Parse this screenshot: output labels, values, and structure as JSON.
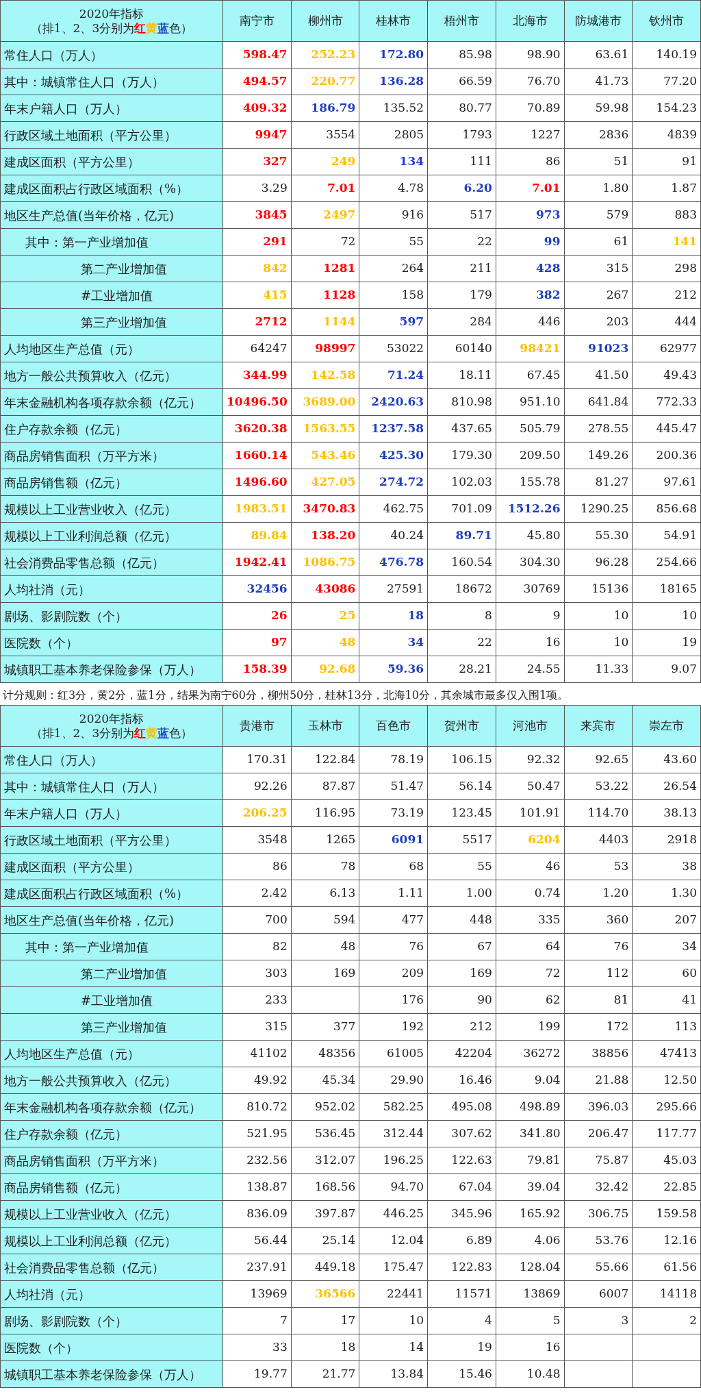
{
  "upper_table": {
    "header": {
      "title": "2020年指标",
      "legend": [
        {
          "text": "（排1、2、3分别为"
        },
        {
          "text": "红",
          "color": "#ff0000"
        },
        {
          "text": "黄",
          "color": "#ffc000"
        },
        {
          "text": "蓝",
          "color": "#1f3fc0"
        },
        {
          "text": "色）"
        }
      ]
    },
    "columns": [
      "南宁市",
      "柳州市",
      "桂林市",
      "梧州市",
      "北海市",
      "防城港市",
      "钦州市"
    ],
    "rows": [
      {
        "label": "常住人口（万人）",
        "cells": [
          {
            "value": "598.47",
            "color": "#ff0000"
          },
          {
            "value": "252.23",
            "color": "#ffc000"
          },
          {
            "value": "172.80",
            "color": "#1f3fc0"
          },
          "85.98",
          "98.90",
          "63.61",
          "140.19"
        ]
      },
      {
        "label": "其中：城镇常住人口（万人）",
        "cells": [
          {
            "value": "494.57",
            "color": "#ff0000"
          },
          {
            "value": "220.77",
            "color": "#ffc000"
          },
          {
            "value": "136.28",
            "color": "#1f3fc0"
          },
          "66.59",
          "76.70",
          "41.73",
          "77.20"
        ]
      },
      {
        "label": "年末户籍人口（万人）",
        "cells": [
          {
            "value": "409.32",
            "color": "#ff0000"
          },
          {
            "value": "186.79",
            "color": "#1f3fc0"
          },
          "135.52",
          "80.77",
          "70.89",
          "59.98",
          "154.23"
        ]
      },
      {
        "label": "行政区域土地面积（平方公里）",
        "cells": [
          {
            "value": "9947",
            "color": "#ff0000"
          },
          "3554",
          "2805",
          "1793",
          "1227",
          "2836",
          "4839"
        ]
      },
      {
        "label": "建成区面积（平方公里）",
        "cells": [
          {
            "value": "327",
            "color": "#ff0000"
          },
          {
            "value": "249",
            "color": "#ffc000"
          },
          {
            "value": "134",
            "color": "#1f3fc0"
          },
          "111",
          "86",
          "51",
          "91"
        ]
      },
      {
        "label": "建成区面积占行政区域面积（%）",
        "cells": [
          "3.29",
          {
            "value": "7.01",
            "color": "#ff0000"
          },
          "4.78",
          {
            "value": "6.20",
            "color": "#1f3fc0"
          },
          {
            "value": "7.01",
            "color": "#ff0000"
          },
          "1.80",
          "1.87"
        ]
      },
      {
        "label": "地区生产总值(当年价格，亿元)",
        "cells": [
          {
            "value": "3845",
            "color": "#ff0000"
          },
          {
            "value": "2497",
            "color": "#ffc000"
          },
          "916",
          "517",
          {
            "value": "973",
            "color": "#1f3fc0"
          },
          "579",
          "883"
        ],
        "children": [
          {
            "label": "其中：第一产业增加值",
            "cells": [
              {
                "value": "291",
                "color": "#ff0000"
              },
              "72",
              "55",
              "22",
              {
                "value": "99",
                "color": "#1f3fc0"
              },
              "61",
              {
                "value": "141",
                "color": "#ffc000"
              }
            ]
          },
          {
            "label": "第二产业增加值",
            "cells": [
              {
                "value": "842",
                "color": "#ffc000"
              },
              {
                "value": "1281",
                "color": "#ff0000"
              },
              "264",
              "211",
              {
                "value": "428",
                "color": "#1f3fc0"
              },
              "315",
              "298"
            ]
          },
          {
            "label": "#工业增加值",
            "cells": [
              {
                "value": "415",
                "color": "#ffc000"
              },
              {
                "value": "1128",
                "color": "#ff0000"
              },
              "158",
              "179",
              {
                "value": "382",
                "color": "#1f3fc0"
              },
              "267",
              "212"
            ]
          },
          {
            "label": "第三产业增加值",
            "cells": [
              {
                "value": "2712",
                "color": "#ff0000"
              },
              {
                "value": "1144",
                "color": "#ffc000"
              },
              {
                "value": "597",
                "color": "#1f3fc0"
              },
              "284",
              "446",
              "203",
              "444"
            ]
          }
        ]
      },
      {
        "label": "人均地区生产总值（元）",
        "cells": [
          "64247",
          {
            "value": "98997",
            "color": "#ff0000"
          },
          "53022",
          "60140",
          {
            "value": "98421",
            "color": "#ffc000"
          },
          {
            "value": "91023",
            "color": "#1f3fc0"
          },
          "62977"
        ]
      },
      {
        "label": "地方一般公共预算收入（亿元）",
        "cells": [
          {
            "value": "344.99",
            "color": "#ff0000"
          },
          {
            "value": "142.58",
            "color": "#ffc000"
          },
          {
            "value": "71.24",
            "color": "#1f3fc0"
          },
          "18.11",
          "67.45",
          "41.50",
          "49.43"
        ]
      },
      {
        "label": "年末金融机构各项存款余额（亿元）",
        "cells": [
          {
            "value": "10496.50",
            "color": "#ff0000"
          },
          {
            "value": "3689.00",
            "color": "#ffc000"
          },
          {
            "value": "2420.63",
            "color": "#1f3fc0"
          },
          "810.98",
          "951.10",
          "641.84",
          "772.33"
        ]
      },
      {
        "label": "住户存款余额（亿元）",
        "cells": [
          {
            "value": "3620.38",
            "color": "#ff0000"
          },
          {
            "value": "1563.55",
            "color": "#ffc000"
          },
          {
            "value": "1237.58",
            "color": "#1f3fc0"
          },
          "437.65",
          "505.79",
          "278.55",
          "445.47"
        ]
      },
      {
        "label": "商品房销售面积（万平方米）",
        "cells": [
          {
            "value": "1660.14",
            "color": "#ff0000"
          },
          {
            "value": "543.46",
            "color": "#ffc000"
          },
          {
            "value": "425.30",
            "color": "#1f3fc0"
          },
          "179.30",
          "209.50",
          "149.26",
          "200.36"
        ]
      },
      {
        "label": "商品房销售额（亿元）",
        "cells": [
          {
            "value": "1496.60",
            "color": "#ff0000"
          },
          {
            "value": "427.05",
            "color": "#ffc000"
          },
          {
            "value": "274.72",
            "color": "#1f3fc0"
          },
          "102.03",
          "155.78",
          "81.27",
          "97.61"
        ]
      },
      {
        "label": "规模以上工业营业收入（亿元）",
        "cells": [
          {
            "value": "1983.51",
            "color": "#ffc000"
          },
          {
            "value": "3470.83",
            "color": "#ff0000"
          },
          "462.75",
          "701.09",
          {
            "value": "1512.26",
            "color": "#1f3fc0"
          },
          "1290.25",
          "856.68"
        ]
      },
      {
        "label": "规模以上工业利润总额（亿元）",
        "cells": [
          {
            "value": "89.84",
            "color": "#ffc000"
          },
          {
            "value": "138.20",
            "color": "#ff0000"
          },
          "40.24",
          {
            "value": "89.71",
            "color": "#1f3fc0"
          },
          "45.80",
          "55.30",
          "54.91"
        ]
      },
      {
        "label": "社会消费品零售总额（亿元）",
        "cells": [
          {
            "value": "1942.41",
            "color": "#ff0000"
          },
          {
            "value": "1086.75",
            "color": "#ffc000"
          },
          {
            "value": "476.78",
            "color": "#1f3fc0"
          },
          "160.54",
          "304.30",
          "96.28",
          "254.66"
        ]
      },
      {
        "label": "人均社消（元）",
        "cells": [
          {
            "value": "32456",
            "color": "#1f3fc0"
          },
          {
            "value": "43086",
            "color": "#ff0000"
          },
          "27591",
          "18672",
          "30769",
          "15136",
          "18165"
        ]
      },
      {
        "label": "剧场、影剧院数（个）",
        "cells": [
          {
            "value": "26",
            "color": "#ff0000"
          },
          {
            "value": "25",
            "color": "#ffc000"
          },
          {
            "value": "18",
            "color": "#1f3fc0"
          },
          "8",
          "9",
          "10",
          "10"
        ]
      },
      {
        "label": "医院数（个）",
        "cells": [
          {
            "value": "97",
            "color": "#ff0000"
          },
          {
            "value": "48",
            "color": "#ffc000"
          },
          {
            "value": "34",
            "color": "#1f3fc0"
          },
          "22",
          "16",
          "10",
          "19"
        ]
      },
      {
        "label": "城镇职工基本养老保险参保（万人）",
        "cells": [
          {
            "value": "158.39",
            "color": "#ff0000"
          },
          {
            "value": "92.68",
            "color": "#ffc000"
          },
          {
            "value": "59.36",
            "color": "#1f3fc0"
          },
          "28.21",
          "24.55",
          "11.33",
          "9.07"
        ]
      }
    ]
  },
  "scoring_note": "计分规则：红3分，黄2分，蓝1分，结果为南宁60分，柳州50分，桂林13分，北海10分，其余城市最多仅入围1项。",
  "lower_table": {
    "header": {
      "title": "2020年指标",
      "legend": [
        {
          "text": "（排1、2、3分别为"
        },
        {
          "text": "红",
          "color": "#ff0000"
        },
        {
          "text": "黄",
          "color": "#ffc000"
        },
        {
          "text": "蓝",
          "color": "#1f3fc0"
        },
        {
          "text": "色）"
        }
      ]
    },
    "columns": [
      "贵港市",
      "玉林市",
      "百色市",
      "贺州市",
      "河池市",
      "来宾市",
      "崇左市"
    ],
    "rows": [
      {
        "label": "常住人口（万人）",
        "cells": [
          "170.31",
          "122.84",
          "78.19",
          "106.15",
          "92.32",
          "92.65",
          "43.60"
        ]
      },
      {
        "label": "其中：城镇常住人口（万人）",
        "cells": [
          "92.26",
          "87.87",
          "51.47",
          "56.14",
          "50.47",
          "53.22",
          "26.54"
        ]
      },
      {
        "label": "年末户籍人口（万人）",
        "cells": [
          {
            "value": "206.25",
            "color": "#ffc000"
          },
          "116.95",
          "73.19",
          "123.45",
          "101.91",
          "114.70",
          "38.13"
        ]
      },
      {
        "label": "行政区域土地面积（平方公里）",
        "cells": [
          "3548",
          "1265",
          {
            "value": "6091",
            "color": "#1f3fc0"
          },
          "5517",
          {
            "value": "6204",
            "color": "#ffc000"
          },
          "4403",
          "2918"
        ]
      },
      {
        "label": "建成区面积（平方公里）",
        "cells": [
          "86",
          "78",
          "68",
          "55",
          "46",
          "53",
          "38"
        ]
      },
      {
        "label": "建成区面积占行政区域面积（%）",
        "cells": [
          "2.42",
          "6.13",
          "1.11",
          "1.00",
          "0.74",
          "1.20",
          "1.30"
        ]
      },
      {
        "label": "地区生产总值(当年价格，亿元)",
        "cells": [
          "700",
          "594",
          "477",
          "448",
          "335",
          "360",
          "207"
        ],
        "children": [
          {
            "label": "其中：第一产业增加值",
            "cells": [
              "82",
              "48",
              "76",
              "67",
              "64",
              "76",
              "34"
            ]
          },
          {
            "label": "第二产业增加值",
            "cells": [
              "303",
              "169",
              "209",
              "169",
              "72",
              "112",
              "60"
            ]
          },
          {
            "label": "#工业增加值",
            "cells": [
              "233",
              null,
              "176",
              "90",
              "62",
              "81",
              "41"
            ]
          },
          {
            "label": "第三产业增加值",
            "cells": [
              "315",
              "377",
              "192",
              "212",
              "199",
              "172",
              "113"
            ]
          }
        ]
      },
      {
        "label": "人均地区生产总值（元）",
        "cells": [
          "41102",
          "48356",
          "61005",
          "42204",
          "36272",
          "38856",
          "47413"
        ]
      },
      {
        "label": "地方一般公共预算收入（亿元）",
        "cells": [
          "49.92",
          "45.34",
          "29.90",
          "16.46",
          "9.04",
          "21.88",
          "12.50"
        ]
      },
      {
        "label": "年末金融机构各项存款余额（亿元）",
        "cells": [
          "810.72",
          "952.02",
          "582.25",
          "495.08",
          "498.89",
          "396.03",
          "295.66"
        ]
      },
      {
        "label": "住户存款余额（亿元）",
        "cells": [
          "521.95",
          "536.45",
          "312.44",
          "307.62",
          "341.80",
          "206.47",
          "117.77"
        ]
      },
      {
        "label": "商品房销售面积（万平方米）",
        "cells": [
          "232.56",
          "312.07",
          "196.25",
          "122.63",
          "79.81",
          "75.87",
          "45.03"
        ]
      },
      {
        "label": "商品房销售额（亿元）",
        "cells": [
          "138.87",
          "168.56",
          "94.70",
          "67.04",
          "39.04",
          "32.42",
          "22.85"
        ]
      },
      {
        "label": "规模以上工业营业收入（亿元）",
        "cells": [
          "836.09",
          "397.87",
          "446.25",
          "345.96",
          "165.92",
          "306.75",
          "159.58"
        ]
      },
      {
        "label": "规模以上工业利润总额（亿元）",
        "cells": [
          "56.44",
          "25.14",
          "12.04",
          "6.89",
          "4.06",
          "53.76",
          "12.16"
        ]
      },
      {
        "label": "社会消费品零售总额（亿元）",
        "cells": [
          "237.91",
          "449.18",
          "175.47",
          "122.83",
          "128.04",
          "55.66",
          "61.56"
        ]
      },
      {
        "label": "人均社消（元）",
        "cells": [
          "13969",
          {
            "value": "36566",
            "color": "#ffc000"
          },
          "22441",
          "11571",
          "13869",
          "6007",
          "14118"
        ]
      },
      {
        "label": "剧场、影剧院数（个）",
        "cells": [
          "7",
          "17",
          "10",
          "4",
          "5",
          "3",
          "2"
        ]
      },
      {
        "label": "医院数（个）",
        "cells": [
          "33",
          "18",
          "14",
          "19",
          "16",
          null,
          null
        ]
      },
      {
        "label": "城镇职工基本养老保险参保（万人）",
        "cells": [
          "19.77",
          "21.77",
          "13.84",
          "15.46",
          "10.48",
          null,
          null
        ]
      }
    ]
  }
}
